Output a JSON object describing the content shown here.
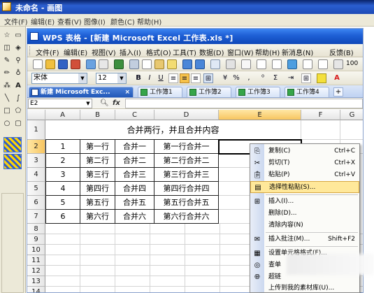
{
  "paint": {
    "title": "未命名 - 画图",
    "menu": [
      "文件(F)",
      "编辑(E)",
      "查看(V)",
      "图像(I)",
      "颜色(C)",
      "帮助(H)"
    ],
    "tools": [
      "select-free",
      "select-rect",
      "eraser",
      "fill",
      "color-picker",
      "magnifier",
      "pencil",
      "brush",
      "airbrush",
      "text",
      "line",
      "curve",
      "rectangle",
      "polygon",
      "ellipse",
      "rounded-rect"
    ]
  },
  "wps": {
    "title": "WPS 表格 - [新建 Microsoft Excel 工作表.xls *]",
    "menu": [
      "文件(F)",
      "编辑(E)",
      "视图(V)",
      "插入(I)",
      "格式(O)",
      "工具(T)",
      "数据(D)",
      "窗口(W)",
      "帮助(H)",
      "新消息(N)",
      "反馈(B)"
    ],
    "font_name": "宋体",
    "font_size": "12",
    "zoom": "100",
    "format_buttons": [
      "B",
      "I",
      "U",
      "%",
      "Σ"
    ],
    "tabs": [
      {
        "label": "新建 Microsoft Exc...",
        "active": true
      },
      {
        "label": "工作簿1",
        "active": false
      },
      {
        "label": "工作簿2",
        "active": false
      },
      {
        "label": "工作簿3",
        "active": false
      },
      {
        "label": "工作簿4",
        "active": false
      }
    ],
    "name_box": "E2",
    "fx_label": "fx",
    "columns": [
      "A",
      "B",
      "C",
      "D",
      "E",
      "F",
      "G"
    ],
    "rows": [
      "1",
      "2",
      "3",
      "4",
      "5",
      "6",
      "7",
      "8",
      "9",
      "10",
      "11",
      "12",
      "13",
      "14"
    ],
    "merged_title": "合并两行，并且合并内容",
    "table": [
      [
        "1",
        "第一行",
        "合并一",
        "第一行合并一"
      ],
      [
        "2",
        "第二行",
        "合并二",
        "第二行合并二"
      ],
      [
        "3",
        "第三行",
        "合并三",
        "第三行合并三"
      ],
      [
        "4",
        "第四行",
        "合并四",
        "第四行合并四"
      ],
      [
        "5",
        "第五行",
        "合并五",
        "第五行合并五"
      ],
      [
        "6",
        "第六行",
        "合并六",
        "第六行合并六"
      ]
    ],
    "colors": {
      "title_bar": "#1e5fd5",
      "highlight": "#ffe89a",
      "tab_active": "#2258b8"
    }
  },
  "context_menu": {
    "items": [
      {
        "label": "复制(C)",
        "shortcut": "Ctrl+C",
        "icon": "copy-icon",
        "highlight": false
      },
      {
        "label": "剪切(T)",
        "shortcut": "Ctrl+X",
        "icon": "scissors-icon",
        "highlight": false
      },
      {
        "label": "粘贴(P)",
        "shortcut": "Ctrl+V",
        "icon": "paste-icon",
        "highlight": false
      },
      {
        "label": "选择性粘贴(S)...",
        "shortcut": "",
        "icon": "paste-special-icon",
        "highlight": true
      },
      {
        "label": "插入(I)...",
        "shortcut": "",
        "icon": "insert-icon",
        "highlight": false
      },
      {
        "label": "删除(D)...",
        "shortcut": "",
        "icon": "",
        "highlight": false
      },
      {
        "label": "清除内容(N)",
        "shortcut": "",
        "icon": "",
        "highlight": false
      },
      {
        "label": "插入批注(M)...",
        "shortcut": "Shift+F2",
        "icon": "comment-icon",
        "highlight": false
      },
      {
        "label": "设置单元格格式(F)...",
        "shortcut": "",
        "icon": "format-cells-icon",
        "highlight": false
      },
      {
        "label": "查单",
        "shortcut": "",
        "icon": "lookup-icon",
        "highlight": false
      },
      {
        "label": "超链",
        "shortcut": "",
        "icon": "hyperlink-icon",
        "highlight": false
      },
      {
        "label": "上传到我的素材库(U)...",
        "shortcut": "",
        "icon": "",
        "highlight": false
      }
    ]
  }
}
